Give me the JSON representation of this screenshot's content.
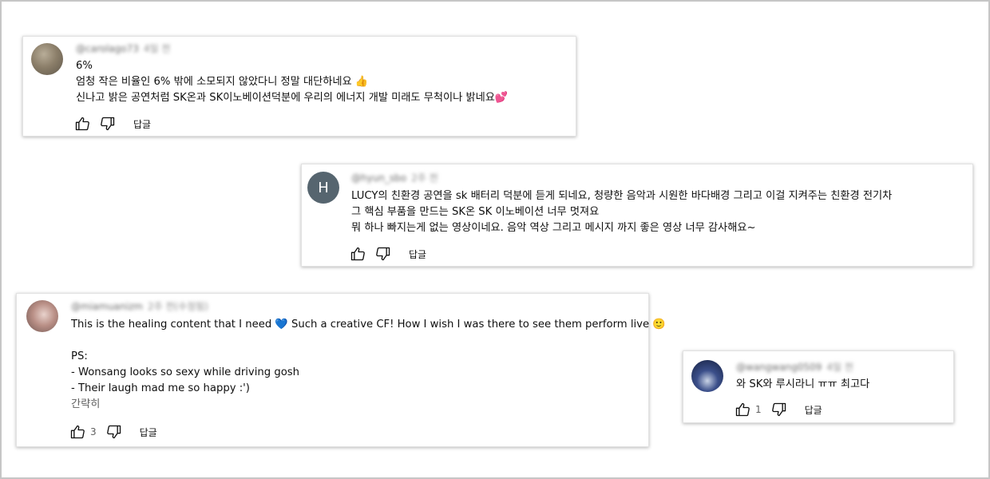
{
  "comments": [
    {
      "author": "@carolago73",
      "time": "4일 전",
      "avatar_color": "#8c7f6a",
      "lines": [
        "6%",
        "엄청 작은 비율인 6% 밖에 소모되지 않았다니 정말 대단하네요 👍",
        "신나고 밝은 공연처럼 SK온과 SK이노베이션덕분에 우리의 에너지 개발 미래도 무척이나 밝네요💕"
      ],
      "likes": "",
      "reply_label": "답글"
    },
    {
      "author": "@hyun_sbo",
      "time": "2주 전",
      "avatar_letter": "H",
      "avatar_color": "#56656f",
      "lines": [
        "LUCY의  친환경 공연을 sk 배터리 덕분에 듣게 되네요, 청량한 음악과 시원한 바다배경 그리고 이걸 지켜주는 친환경 전기차",
        "그 핵심 부품을 만드는 SK온 SK 이노베이션 너무 멋져요",
        "뭐 하나 빠지는게 없는 영상이네요. 음악 역상 그리고 메시지 까지 좋은 영상 너무 감사해요~"
      ],
      "likes": "",
      "reply_label": "답글"
    },
    {
      "author": "@miamuanizm",
      "time": "2주 전(수정됨)",
      "avatar_color": "#b98f86",
      "lines": [
        "This is the healing content that I need 💙 Such a creative CF! How I wish I was there to see them perform live 🙂",
        "",
        "PS:",
        "- Wonsang looks so sexy while driving gosh",
        "- Their laugh mad me so happy :')"
      ],
      "more_label": "간략히",
      "likes": "3",
      "reply_label": "답글"
    },
    {
      "author": "@wangwang0509",
      "time": "4일 전",
      "avatar_color": "#3b4f8a",
      "lines": [
        "와 SK와 루시라니 ㅠㅠ 최고다"
      ],
      "likes": "1",
      "reply_label": "답글"
    }
  ],
  "icons": {
    "like": "thumb-up-icon",
    "dislike": "thumb-down-icon"
  }
}
